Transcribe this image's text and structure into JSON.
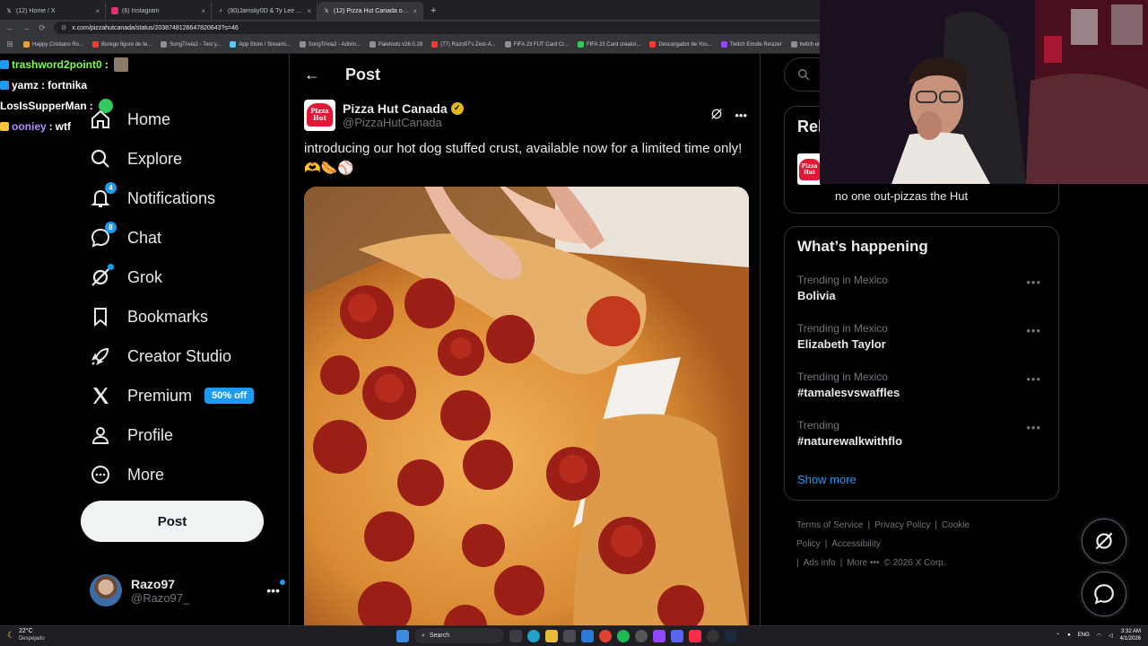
{
  "browser": {
    "tabs": [
      {
        "label": "(12) Home / X",
        "favicon": "x-favicon",
        "color": "#ffffff"
      },
      {
        "label": "(6) Instagram",
        "favicon": "instagram-favicon",
        "color": "#e1306c"
      },
      {
        "label": "(90)Jamsliy0D & Ty Lee Erome",
        "favicon": "tiktok-favicon",
        "color": "#ffffff"
      },
      {
        "label": "(12) Pizza Hut Canada on X: \"in",
        "favicon": "x-favicon",
        "color": "#ffffff"
      }
    ],
    "new_tab": "+",
    "url": "x.com/pizzahutcanada/status/2038748126647820643?s=46",
    "bookmarks": [
      {
        "label": "Happy Cristiano Ro...",
        "color": "#e8a23b"
      },
      {
        "label": "Burego figure de te...",
        "color": "#ff3b30"
      },
      {
        "label": "SongTrivia2 - Test y...",
        "color": "#8e8e93"
      },
      {
        "label": "App Store / Streami...",
        "color": "#5ac8fa"
      },
      {
        "label": "SongTrivia2 - Adivin...",
        "color": "#8e8e93"
      },
      {
        "label": "Paletools v26.0.28",
        "color": "#8e8e93"
      },
      {
        "label": "(77) Razo97's Zest-A...",
        "color": "#ff3b30"
      },
      {
        "label": "FIFA 23 FUT Card Cr...",
        "color": "#8e8e93"
      },
      {
        "label": "FIFA 23 Card creator...",
        "color": "#34c759"
      },
      {
        "label": "Descargador de You...",
        "color": "#ff3b30"
      },
      {
        "label": "Twitch Emote Resizer",
        "color": "#9146ff"
      },
      {
        "label": "twitch emote re...",
        "color": "#8e8e93"
      }
    ]
  },
  "chat": [
    {
      "user": "trashword2point0",
      "message": "",
      "color": "#7dff4a"
    },
    {
      "user": "yamz",
      "message": "fortnika",
      "color": "#ffffff"
    },
    {
      "user": "LosIsSupperMan",
      "message": "",
      "color": "#ffffff"
    },
    {
      "user": "ooniey",
      "message": "wtf",
      "color": "#b48cff"
    }
  ],
  "nav": [
    {
      "label": "Home",
      "icon": "home-icon"
    },
    {
      "label": "Explore",
      "icon": "search-icon"
    },
    {
      "label": "Notifications",
      "icon": "bell-icon",
      "badge": "4"
    },
    {
      "label": "Chat",
      "icon": "chat-icon",
      "badge": "8"
    },
    {
      "label": "Grok",
      "icon": "grok-icon"
    },
    {
      "label": "Bookmarks",
      "icon": "bookmark-icon"
    },
    {
      "label": "Creator Studio",
      "icon": "rocket-icon"
    },
    {
      "label": "Premium",
      "icon": "x-logo-icon",
      "pill": "50% off"
    },
    {
      "label": "Profile",
      "icon": "person-icon"
    },
    {
      "label": "More",
      "icon": "more-circle-icon"
    }
  ],
  "post_button": "Post",
  "account": {
    "name": "Razo97",
    "handle": "@Razo97_",
    "more": "•••"
  },
  "post": {
    "header_title": "Post",
    "author_name": "Pizza Hut Canada",
    "author_handle": "@PizzaHutCanada",
    "logo_text": "Pizza Hut",
    "text": "introducing our hot dog stuffed crust, available now for a limited time only! 🫶🌭⚾",
    "more": "•••"
  },
  "right": {
    "search_placeholder": "Se",
    "relevant_title": "Rel",
    "relevant_bio": "no one out-pizzas the Hut",
    "happening_title": "What’s happening",
    "trends": [
      {
        "context": "Trending in Mexico",
        "name": "Bolivia"
      },
      {
        "context": "Trending in Mexico",
        "name": "Elizabeth Taylor"
      },
      {
        "context": "Trending in Mexico",
        "name": "#tamalesvswaffles"
      },
      {
        "context": "Trending",
        "name": "#naturewalkwithflo"
      }
    ],
    "trend_more": "•••",
    "show_more": "Show more",
    "footer": [
      "Terms of Service",
      "|",
      "Privacy Policy",
      "|",
      "Cookie Policy",
      "|",
      "Accessibility",
      "|",
      "Ads info",
      "|",
      "More •••",
      "© 2026 X Corp."
    ]
  },
  "taskbar": {
    "temp": "22°C",
    "weather": "Despejado",
    "search": "Search",
    "lang": "ENG",
    "time": "3:32 AM",
    "date": "4/1/2026"
  },
  "colors": {
    "accent": "#1d9bf0",
    "verified": "#e2b719",
    "brand": "#e31837"
  }
}
